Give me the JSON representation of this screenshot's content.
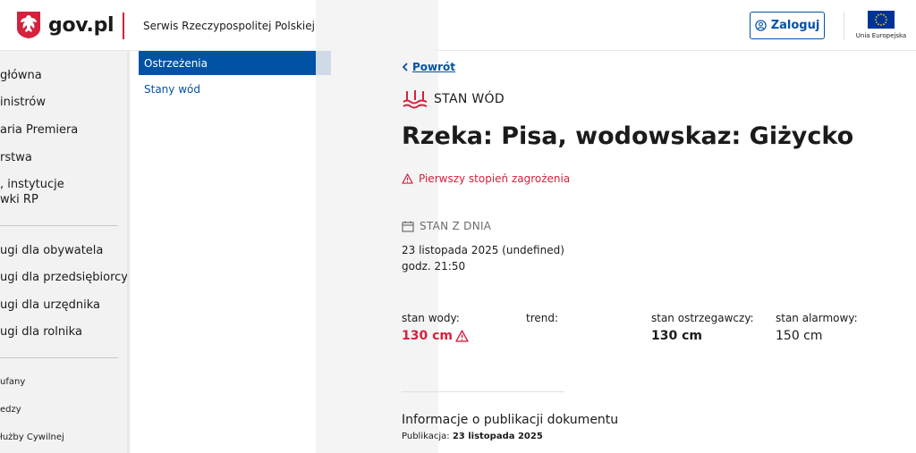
{
  "header": {
    "logo_text": "gov.pl",
    "service_name": "Serwis Rzeczypospolitej Polskiej",
    "login_label": "Zaloguj",
    "eu_label": "Unia Europejska"
  },
  "left_nav": {
    "items": [
      "główna",
      "inistrów",
      "aria Premiera",
      "rstwa",
      ", instytucje",
      "wki RP",
      "ugi dla obywatela",
      "ugi dla przedsiębiorcy",
      "ugi dla urzędnika",
      "ugi dla rolnika",
      "ufany",
      "edzy",
      "łużby Cywilnej"
    ]
  },
  "sub_nav": {
    "active": "Ostrzeżenia",
    "other": "Stany wód"
  },
  "main": {
    "back_label": "Powrót",
    "section_label": "STAN WÓD",
    "title": "Rzeka: Pisa, wodowskaz: Giżycko",
    "alert": "Pierwszy stopień zagrożenia",
    "date_label": "STAN Z DNIA",
    "date_value": "23 listopada 2025 (undefined)",
    "time_value": "godz. 21:50",
    "metrics": {
      "water_label": "stan wody:",
      "water_value": "130 cm",
      "trend_label": "trend:",
      "warning_label": "stan ostrzegawczy:",
      "warning_value": "130 cm",
      "alarm_label": "stan alarmowy:",
      "alarm_value": "150 cm"
    },
    "pub_title": "Informacje o publikacji dokumentu",
    "pub_prefix": "Publikacja:",
    "pub_date": "23 listopada 2025"
  },
  "colors": {
    "primary": "#0052a5",
    "alert": "#d4213d"
  }
}
